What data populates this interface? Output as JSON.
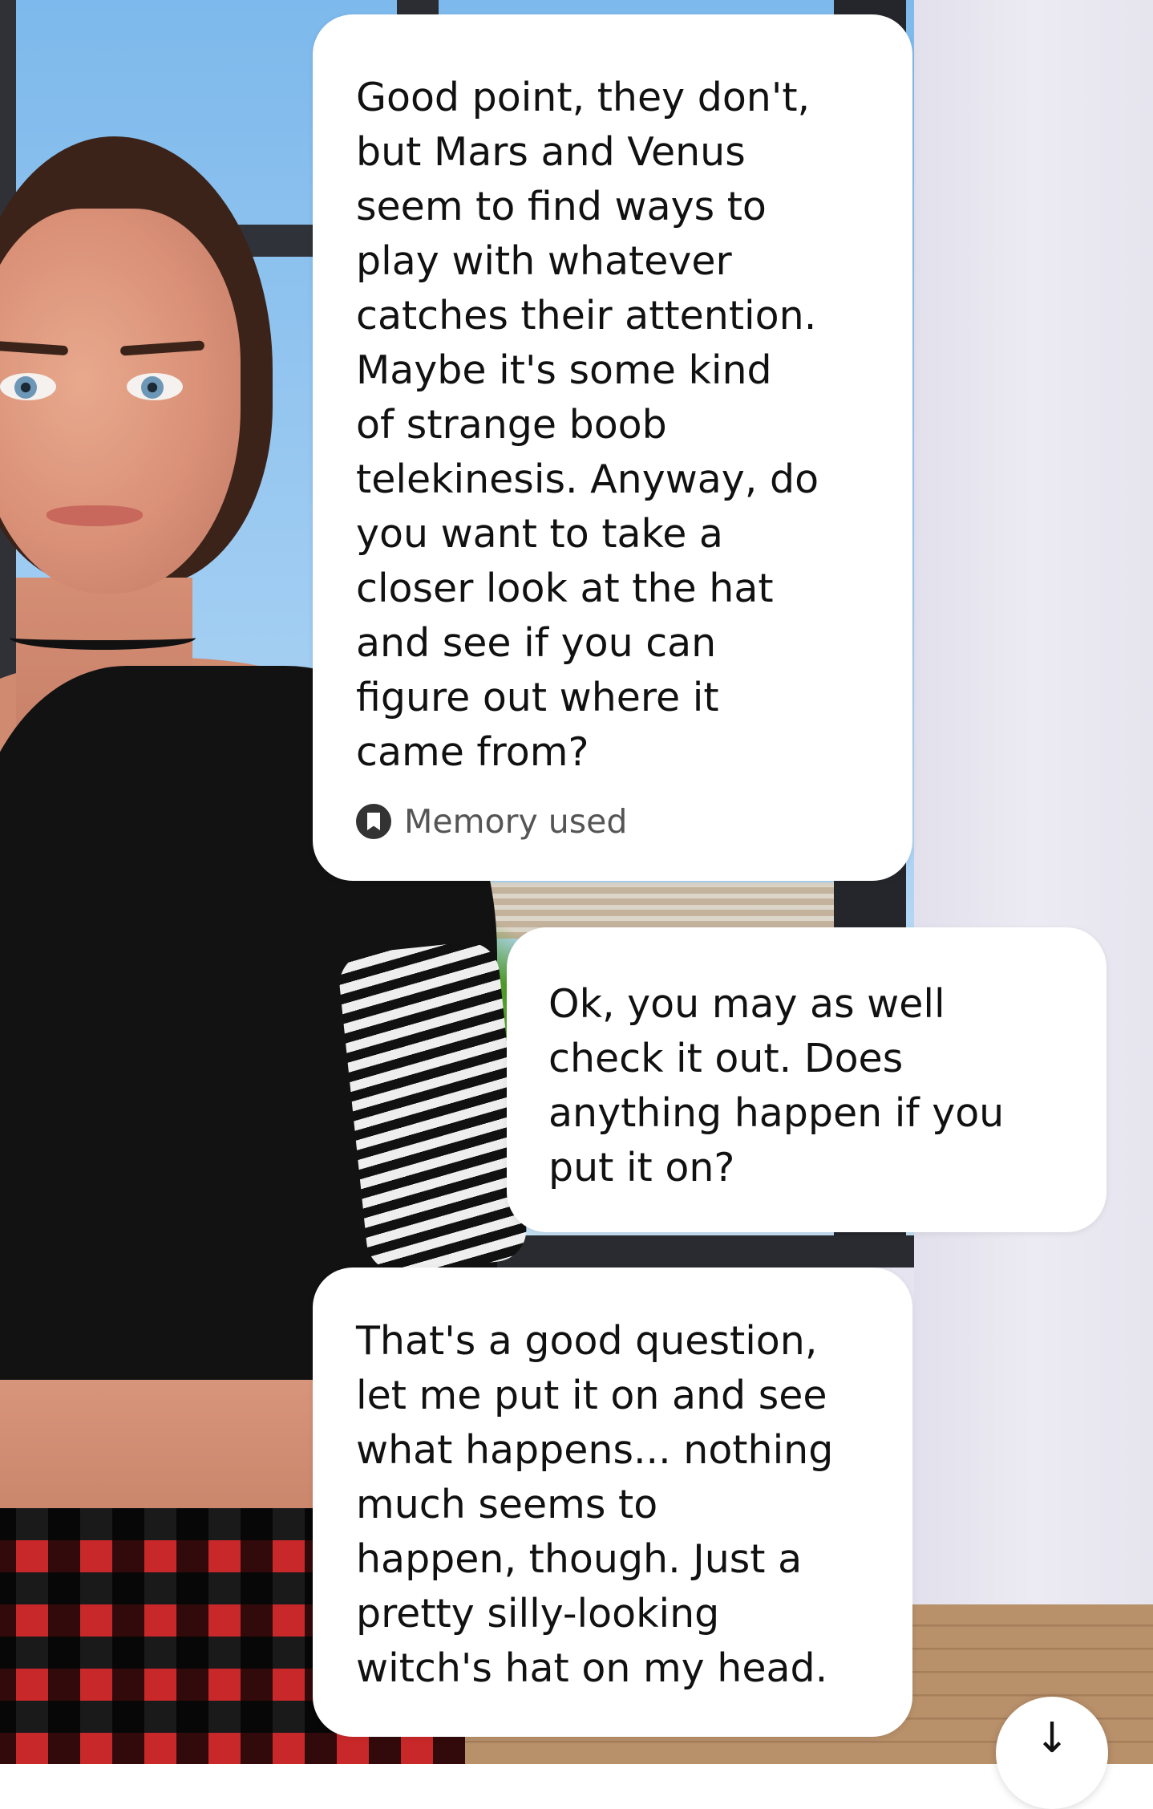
{
  "chat": {
    "messages": [
      {
        "sender": "ai",
        "text": "Good point, they don't,\nbut Mars and Venus\nseem to find ways to\nplay with whatever\ncatches their attention.\nMaybe it's some kind\nof strange boob\ntelekinesis. Anyway, do\nyou want to take a\ncloser look at the hat\nand see if you can\nfigure out where it\ncame from?",
        "memory_label": "Memory used",
        "memory_icon": "bookmark-icon"
      },
      {
        "sender": "user",
        "text": "Ok, you may as well\ncheck it out.   Does\nanything happen if you\nput it on?"
      },
      {
        "sender": "ai",
        "text": "That's a good question,\nlet me put it on and see\nwhat happens... nothing\nmuch seems to\nhappen, though. Just a\npretty silly-looking\nwitch's hat on my head."
      }
    ]
  },
  "scroll_button": {
    "icon": "arrow-down-icon",
    "glyph": "↓"
  },
  "colors": {
    "bubble": "#ffffff",
    "text": "#111111",
    "memory_text": "#555555"
  }
}
